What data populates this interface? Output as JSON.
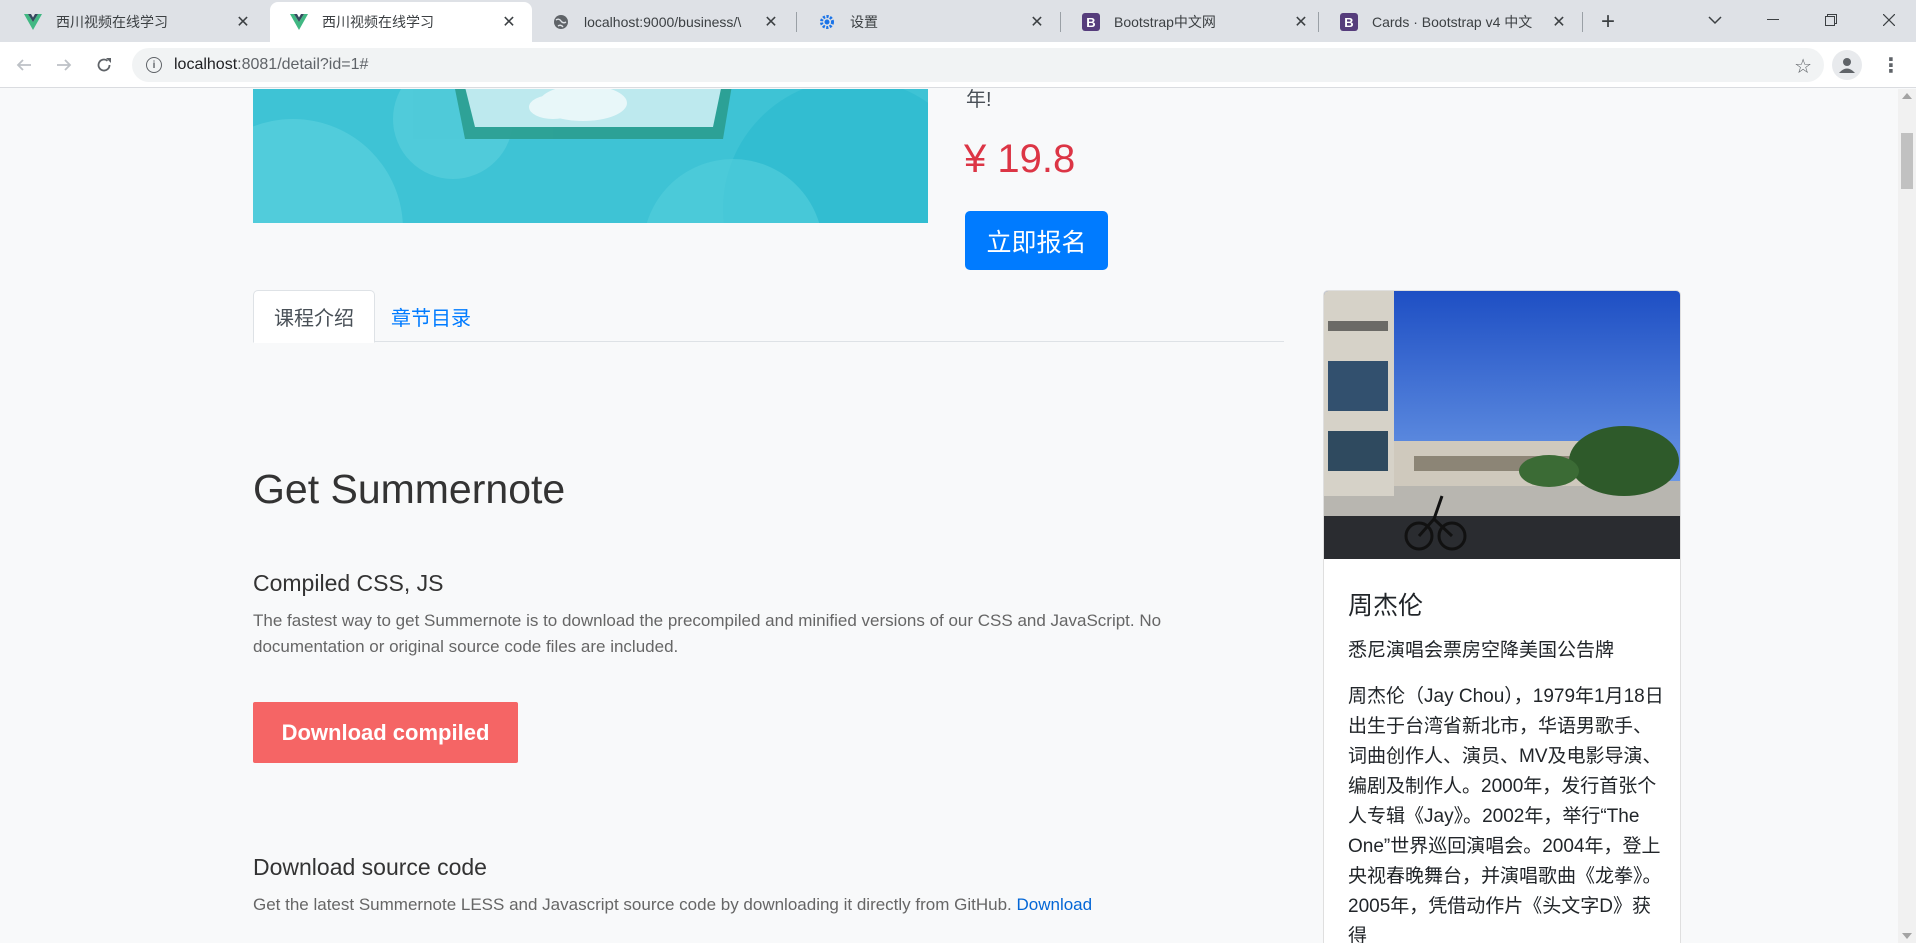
{
  "browser": {
    "tabs": [
      {
        "title": "西川视频在线学习",
        "favicon": "vue-logo-icon",
        "active": false
      },
      {
        "title": "西川视频在线学习",
        "favicon": "vue-logo-icon",
        "active": true
      },
      {
        "title": "localhost:9000/business/\\",
        "favicon": "globe-icon",
        "active": false
      },
      {
        "title": "设置",
        "favicon": "gear-icon",
        "active": false
      },
      {
        "title": "Bootstrap中文网",
        "favicon": "bootstrap-icon",
        "active": false
      },
      {
        "title": "Cards · Bootstrap v4 中文",
        "favicon": "bootstrap-icon",
        "active": false
      }
    ],
    "new_tab_label": "+",
    "url_host": "localhost",
    "url_rest": ":8081/detail?id=1#"
  },
  "course": {
    "description_tail": "年!",
    "price": "¥ 19.8",
    "enroll_label": "立即报名"
  },
  "content_tabs": {
    "intro": "课程介绍",
    "chapters": "章节目录"
  },
  "article": {
    "heading": "Get Summernote",
    "section1_title": "Compiled CSS, JS",
    "section1_text": "The fastest way to get Summernote is to download the precompiled and minified versions of our CSS and JavaScript. No documentation or original source code files are included.",
    "download_compiled_label": "Download compiled",
    "section2_title": "Download source code",
    "section2_text": "Get the latest Summernote LESS and Javascript source code by downloading it directly from GitHub. ",
    "section2_link": "Download"
  },
  "teacher_card": {
    "name": "周杰伦",
    "subtitle": "悉尼演唱会票房空降美国公告牌",
    "bio": "周杰伦（Jay Chou），1979年1月18日出生于台湾省新北市，华语男歌手、词曲创作人、演员、MV及电影导演、编剧及制作人。2000年，发行首张个人专辑《Jay》。2002年，举行“The One”世界巡回演唱会。2004年，登上央视春晚舞台，并演唱歌曲《龙拳》。2005年，凭借动作片《头文字D》获得"
  },
  "colors": {
    "primary": "#007bff",
    "price_red": "#dc3545",
    "download_btn": "#f56565",
    "page_bg": "#f8f9fa"
  }
}
